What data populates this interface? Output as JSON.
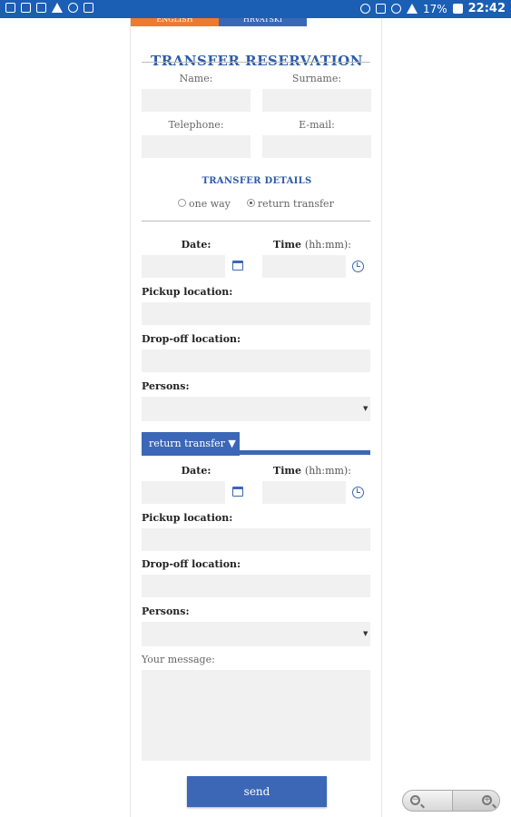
{
  "status_bar": {
    "battery": "17%",
    "time": "22:42"
  },
  "lang_tabs": [
    "ENGLISH",
    "HRVATSKI"
  ],
  "title": "TRANSFER RESERVATION",
  "contact": {
    "name_label": "Name:",
    "surname_label": "Surname:",
    "telephone_label": "Telephone:",
    "email_label": "E-mail:"
  },
  "transfer_details": {
    "heading": "TRANSFER DETAILS",
    "option_one_way": "one way",
    "option_return": "return transfer",
    "selected": "return transfer"
  },
  "outbound": {
    "date_label": "Date:",
    "time_label": "Time",
    "time_hint": "(hh:mm):",
    "pickup_label": "Pickup location:",
    "dropoff_label": "Drop-off location:",
    "persons_label": "Persons:"
  },
  "return_section": {
    "tab_label": "return transfer ▼",
    "date_label": "Date:",
    "time_label": "Time",
    "time_hint": "(hh:mm):",
    "pickup_label": "Pickup location:",
    "dropoff_label": "Drop-off location:",
    "persons_label": "Persons:"
  },
  "message_label": "Your message:",
  "send_label": "send",
  "icons": {
    "calendar": "calendar-icon",
    "clock": "clock-icon",
    "zoom_out": "zoom-out-icon",
    "zoom_in": "zoom-in-icon"
  },
  "colors": {
    "accent_blue": "#3b67b6",
    "title_blue": "#2d5ba8",
    "english_orange": "#f07a2c",
    "field_bg": "#f1f1f1"
  }
}
